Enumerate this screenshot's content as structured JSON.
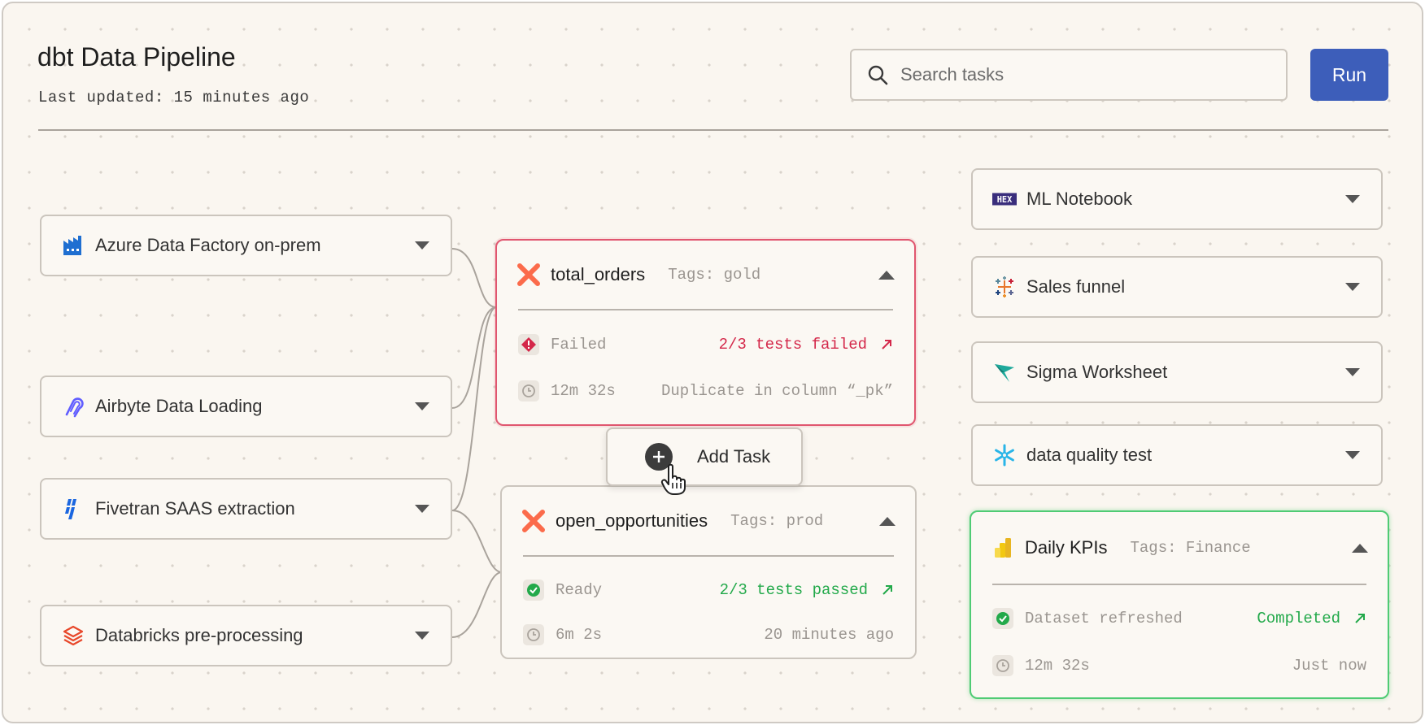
{
  "header": {
    "title": "dbt Data Pipeline",
    "subtitle": "Last updated: 15 minutes ago",
    "search_placeholder": "Search tasks",
    "run_label": "Run"
  },
  "sources": [
    {
      "label": "Azure Data Factory on-prem",
      "icon": "azure-factory-icon"
    },
    {
      "label": "Airbyte Data Loading",
      "icon": "airbyte-icon"
    },
    {
      "label": "Fivetran SAAS extraction",
      "icon": "fivetran-icon"
    },
    {
      "label": "Databricks pre-processing",
      "icon": "databricks-icon"
    }
  ],
  "tasks": [
    {
      "name": "total_orders",
      "tags": "Tags: gold",
      "status": "Failed",
      "result": "2/3 tests failed",
      "duration": "12m 32s",
      "detail": "Duplicate in column “_pk”",
      "state": "failed"
    },
    {
      "name": "open_opportunities",
      "tags": "Tags: prod",
      "status": "Ready",
      "result": "2/3 tests passed",
      "duration": "6m 2s",
      "detail": "20 minutes ago",
      "state": "ready"
    }
  ],
  "add_task": {
    "label": "Add Task"
  },
  "destinations": [
    {
      "label": "ML Notebook",
      "icon": "hex-icon"
    },
    {
      "label": "Sales funnel",
      "icon": "tableau-icon"
    },
    {
      "label": "Sigma Worksheet",
      "icon": "sigma-icon"
    },
    {
      "label": "data quality test",
      "icon": "snowflake-icon"
    }
  ],
  "kpi": {
    "name": "Daily KPIs",
    "tags": "Tags: Finance",
    "status": "Dataset refreshed",
    "result": "Completed",
    "duration": "12m 32s",
    "detail": "Just now",
    "icon": "powerbi-icon"
  },
  "colors": {
    "accent": "#3d5eba",
    "failed": "#d4284a",
    "success": "#22a94a",
    "background": "#faf6f0"
  }
}
